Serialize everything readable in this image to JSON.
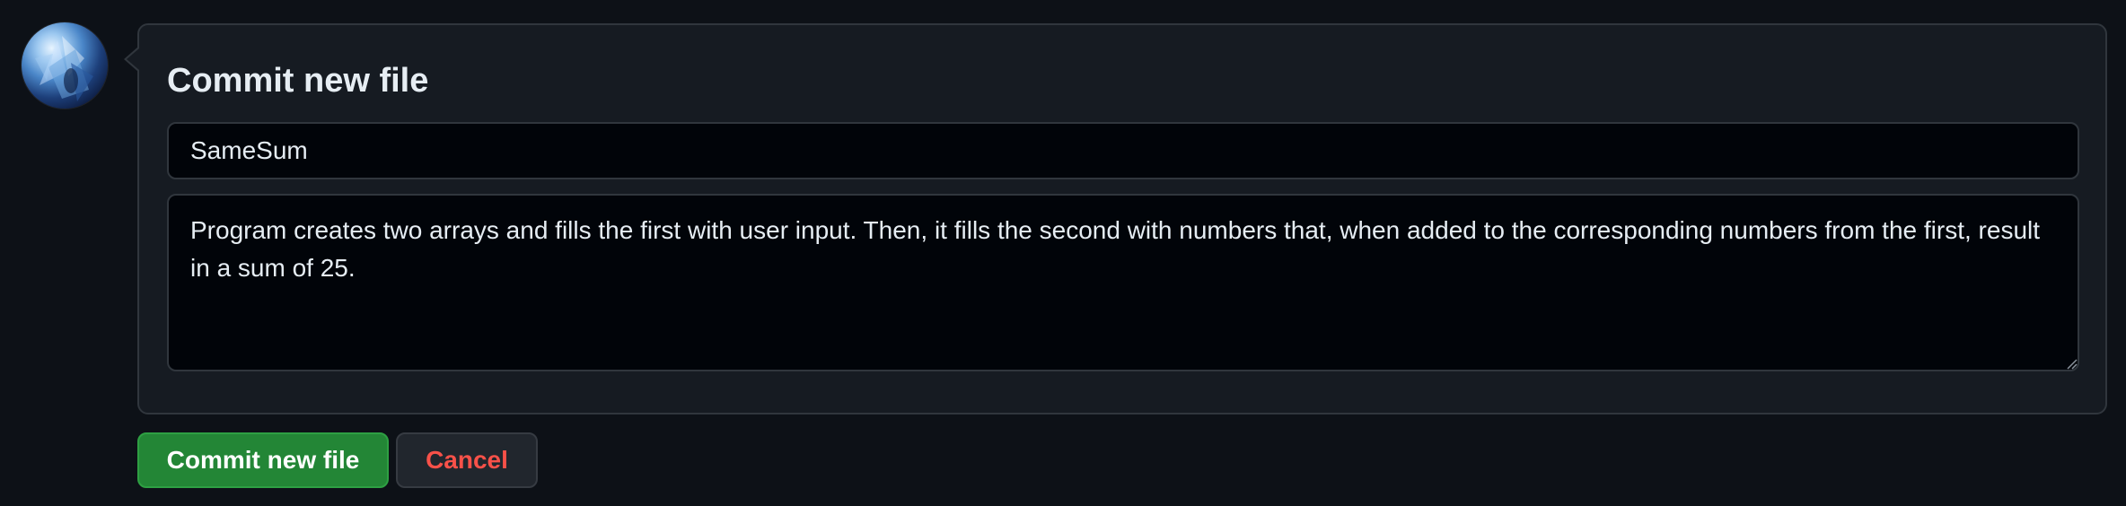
{
  "avatar": {
    "icon": "user-avatar"
  },
  "commit_form": {
    "title": "Commit new file",
    "summary_value": "SameSum",
    "description_value": "Program creates two arrays and fills the first with user input. Then, it fills the second with numbers that, when added to the corresponding numbers from the first, result in a sum of 25."
  },
  "actions": {
    "commit_label": "Commit new file",
    "cancel_label": "Cancel"
  },
  "colors": {
    "background": "#0d1117",
    "panel": "#161b22",
    "border": "#30363d",
    "commit_button": "#238636",
    "cancel_text": "#f85149"
  }
}
